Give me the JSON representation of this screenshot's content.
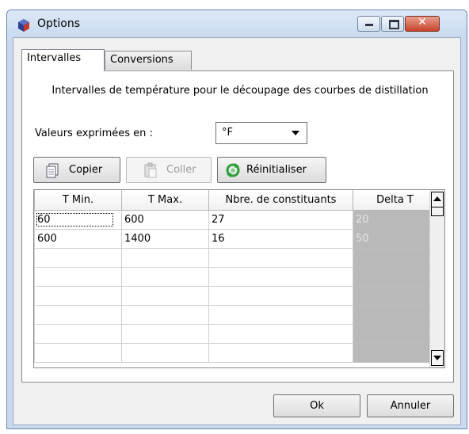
{
  "window": {
    "title": "Options"
  },
  "icons": {
    "app": "app-icon",
    "copy": "copy-icon",
    "paste": "paste-icon",
    "reset": "reset-icon",
    "minimize": "minimize-icon",
    "maximize": "maximize-icon",
    "close": "close-icon"
  },
  "tabs": [
    {
      "label": "Intervalles",
      "active": true
    },
    {
      "label": "Conversions",
      "active": false
    }
  ],
  "main": {
    "description": "Intervalles de température pour le découpage des courbes de distillation",
    "units_label": "Valeurs exprimées en :",
    "units_value": "°F",
    "buttons": {
      "copy": "Copier",
      "paste": "Coller",
      "reset": "Réinitialiser"
    },
    "table": {
      "columns": [
        "T Min.",
        "T Max.",
        "Nbre. de constituants",
        "Delta T"
      ],
      "rows": [
        [
          "60",
          "600",
          "27",
          "20"
        ],
        [
          "600",
          "1400",
          "16",
          "50"
        ]
      ],
      "empty_rows": 6
    }
  },
  "footer": {
    "ok": "Ok",
    "cancel": "Annuler"
  },
  "colors": {
    "delta_column": "#b9b9b9",
    "window_frame": "#c9d9ee",
    "close_button": "#c7432a"
  }
}
